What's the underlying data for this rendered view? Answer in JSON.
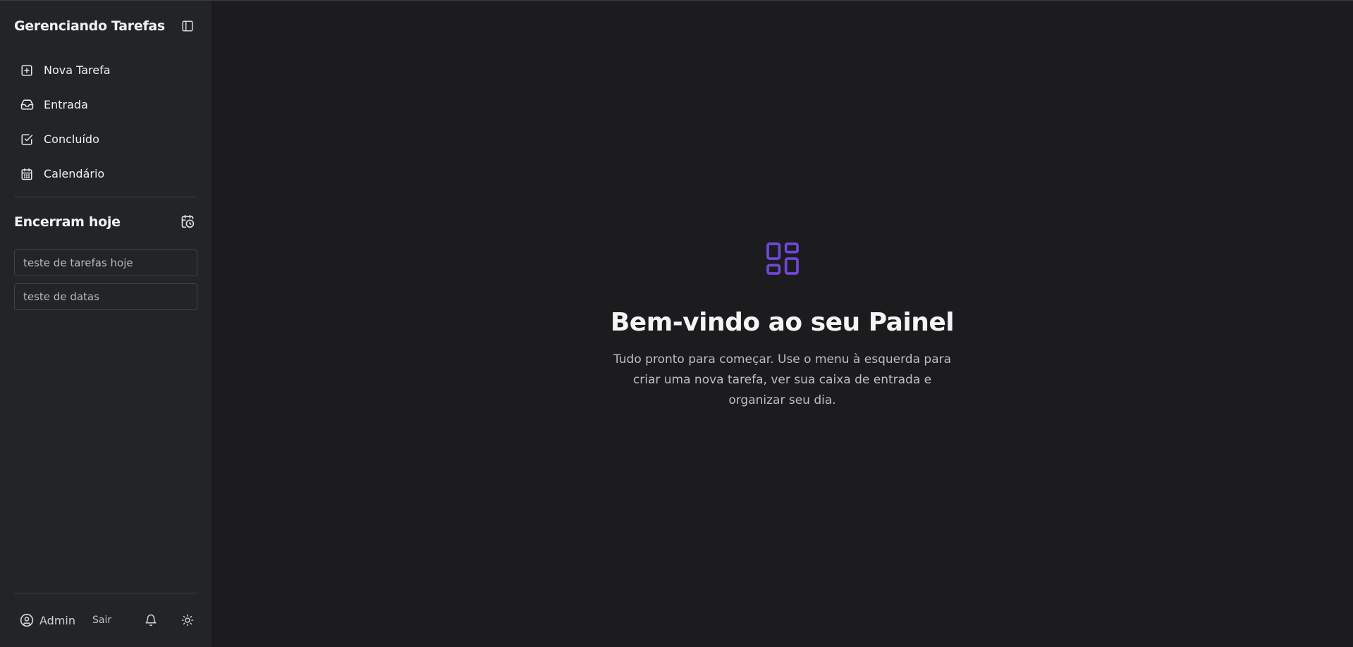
{
  "app": {
    "title": "Gerenciando Tarefas"
  },
  "sidebar": {
    "nav": [
      {
        "label": "Nova Tarefa",
        "icon": "plus-square-icon"
      },
      {
        "label": "Entrada",
        "icon": "inbox-icon"
      },
      {
        "label": "Concluído",
        "icon": "check-square-icon"
      },
      {
        "label": "Calendário",
        "icon": "calendar-icon"
      }
    ],
    "due_today": {
      "title": "Encerram hoje",
      "tasks": [
        "teste de tarefas hoje",
        "teste de datas"
      ]
    },
    "footer": {
      "user": "Admin",
      "logout": "Sair"
    }
  },
  "main": {
    "title": "Bem-vindo ao seu Painel",
    "text": "Tudo pronto para começar. Use o menu à esquerda para criar uma nova tarefa, ver sua caixa de entrada e organizar seu dia."
  },
  "colors": {
    "accent": "#6f47d9",
    "sidebar_bg": "#222527",
    "main_bg": "#1c1c1e"
  }
}
